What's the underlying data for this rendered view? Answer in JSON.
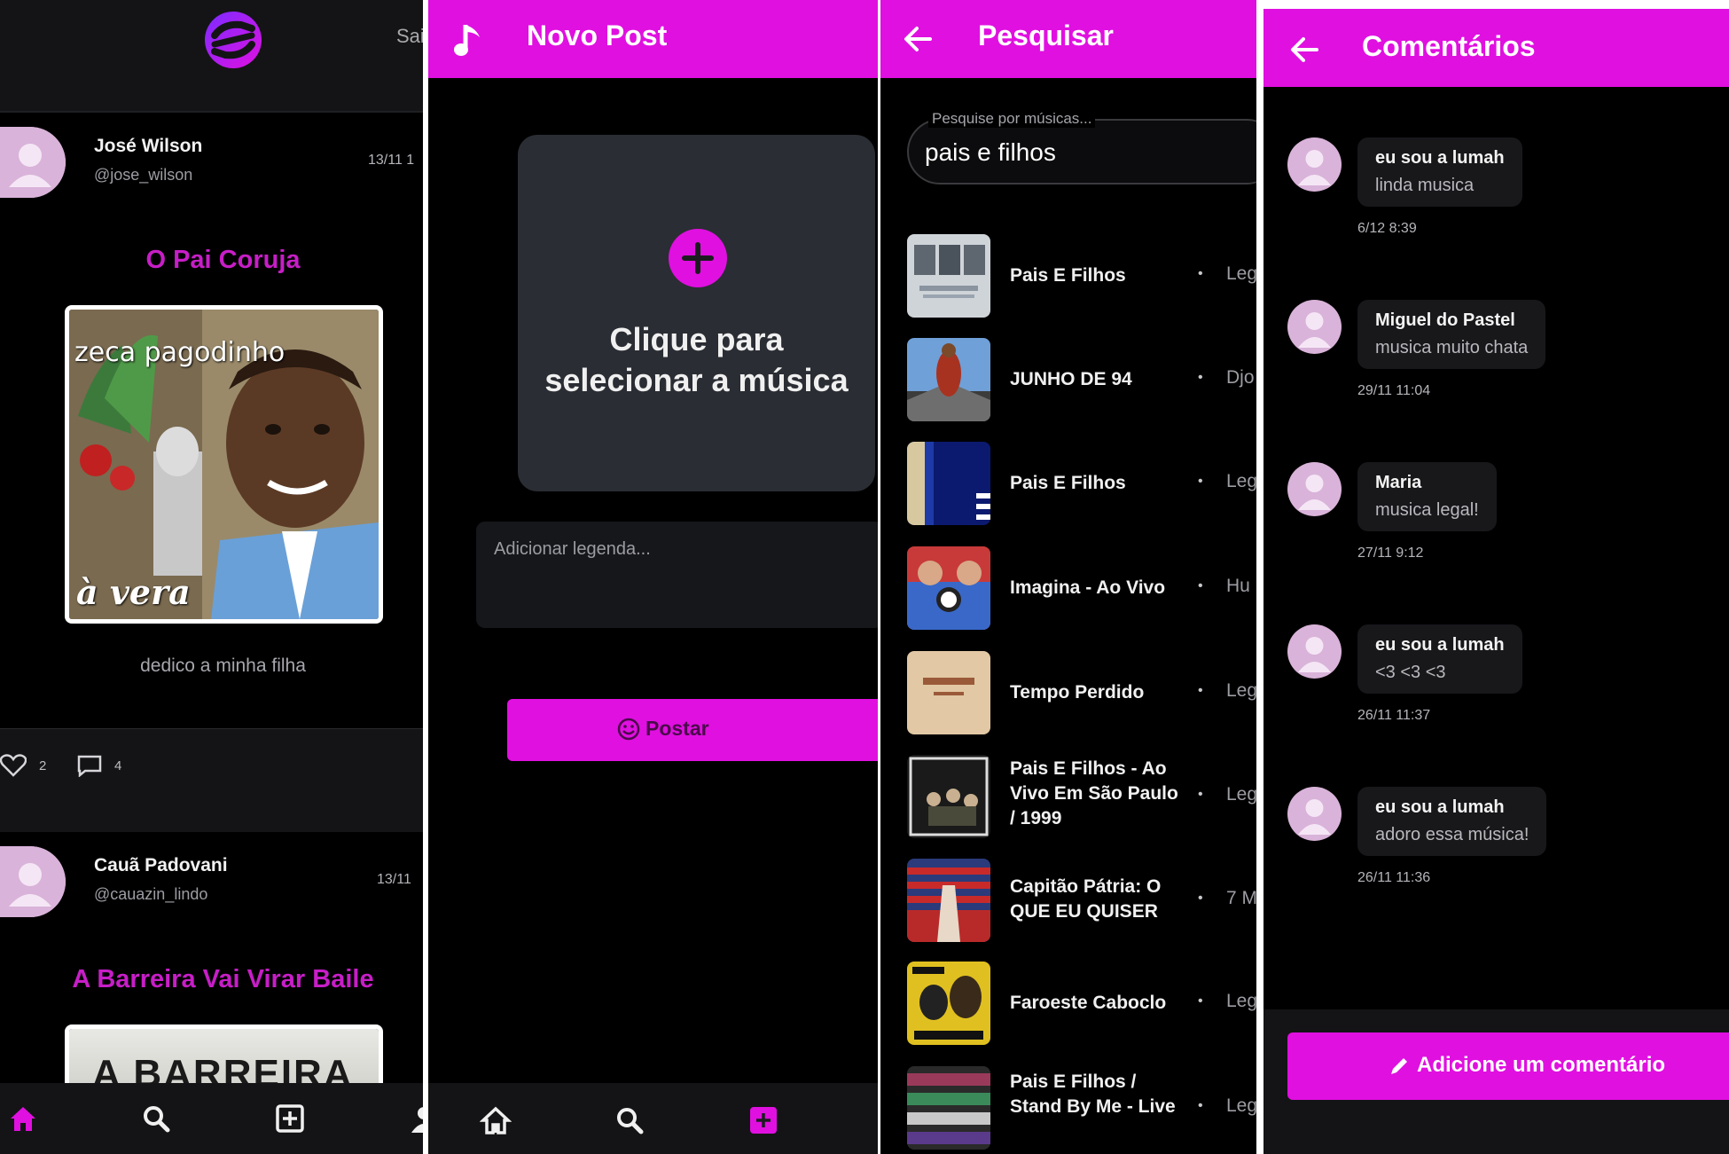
{
  "colors": {
    "accent": "#e010e0",
    "background": "#000000",
    "surface": "#141416",
    "card": "#2a2d33"
  },
  "feed": {
    "sair_label": "Sai",
    "posts": [
      {
        "name": "José Wilson",
        "handle": "@jose_wilson",
        "date": "13/11 1",
        "song": "O Pai Coruja",
        "cover_text_top": "zeca pagodinho",
        "cover_text_bottom": "à vera",
        "caption": "dedico a minha filha",
        "likes": "2",
        "comments": "4"
      },
      {
        "name": "Cauã Padovani",
        "handle": "@cauazin_lindo",
        "date": "13/11",
        "song": "A Barreira Vai Virar Baile",
        "cover_text": "A BARREIRA"
      }
    ],
    "nav": [
      "home-icon",
      "search-icon",
      "add-square-icon",
      "profile-icon"
    ]
  },
  "novo_post": {
    "title": "Novo Post",
    "select_line1": "Clique para",
    "select_line2": "selecionar a música",
    "legend_placeholder": "Adicionar legenda...",
    "postar_label": "Postar",
    "nav": [
      "home-icon",
      "search-icon",
      "add-square-icon"
    ]
  },
  "pesquisar": {
    "title": "Pesquisar",
    "search_label": "Pesquise por músicas...",
    "search_value": "pais e filhos",
    "results": [
      {
        "title": "Pais E Filhos",
        "artist": "Leg"
      },
      {
        "title": "JUNHO DE 94",
        "artist": "Djo"
      },
      {
        "title": "Pais E Filhos",
        "artist": "Leg"
      },
      {
        "title": "Imagina - Ao Vivo",
        "artist": "Hu"
      },
      {
        "title": "Tempo Perdido",
        "artist": "Leg"
      },
      {
        "title": "Pais E Filhos - Ao Vivo Em São Paulo / 1999",
        "artist": "Leg"
      },
      {
        "title": "Capitão Pátria: O QUE EU QUISER",
        "artist": "7 M"
      },
      {
        "title": "Faroeste Caboclo",
        "artist": "Leg"
      },
      {
        "title": "Pais E Filhos / Stand By Me - Live",
        "artist": "Leg"
      }
    ]
  },
  "comentarios": {
    "title": "Comentários",
    "comments": [
      {
        "name": "eu sou a lumah",
        "text": "linda musica",
        "time": "6/12 8:39"
      },
      {
        "name": "Miguel do Pastel",
        "text": "musica muito chata",
        "time": "29/11 11:04"
      },
      {
        "name": "Maria",
        "text": "musica legal!",
        "time": "27/11 9:12"
      },
      {
        "name": "eu sou a lumah",
        "text": "<3 <3 <3",
        "time": "26/11 11:37"
      },
      {
        "name": "eu sou a lumah",
        "text": "adoro essa música!",
        "time": "26/11 11:36"
      }
    ],
    "add_label": "Adicione um comentário"
  }
}
